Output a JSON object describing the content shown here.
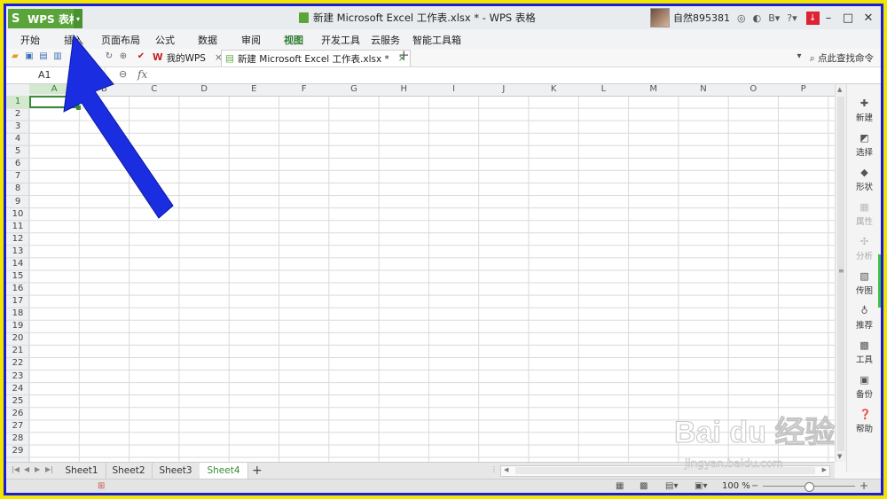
{
  "app": {
    "name_button": "WPS 表格",
    "window_title": "新建 Microsoft Excel 工作表.xlsx * - WPS 表格",
    "username": "自然895381"
  },
  "ribbon": {
    "tabs": [
      "开始",
      "插入",
      "页面布局",
      "公式",
      "数据",
      "审阅",
      "视图",
      "开发工具",
      "云服务",
      "智能工具箱"
    ],
    "active_tab": "视图"
  },
  "doc_tabs": [
    {
      "label": "我的WPS",
      "close": "×"
    },
    {
      "label": "新建 Microsoft Excel 工作表.xlsx *",
      "close": "×"
    }
  ],
  "find_command": "点此查找命令",
  "formula_bar": {
    "name_box": "A1",
    "fx_label": "fx",
    "value": ""
  },
  "columns": [
    "A",
    "B",
    "C",
    "D",
    "E",
    "F",
    "G",
    "H",
    "I",
    "J",
    "K",
    "L",
    "M",
    "N",
    "O",
    "P"
  ],
  "rows": [
    "1",
    "2",
    "3",
    "4",
    "5",
    "6",
    "7",
    "8",
    "9",
    "10",
    "11",
    "12",
    "13",
    "14",
    "15",
    "16",
    "17",
    "18",
    "19",
    "20",
    "21",
    "22",
    "23",
    "24",
    "25",
    "26",
    "27",
    "28",
    "29"
  ],
  "sidebar": [
    {
      "label": "新建",
      "icon": "plus-icon",
      "enabled": true
    },
    {
      "label": "选择",
      "icon": "select-icon",
      "enabled": true
    },
    {
      "label": "形状",
      "icon": "shape-icon",
      "enabled": true
    },
    {
      "label": "属性",
      "icon": "properties-icon",
      "enabled": false
    },
    {
      "label": "分析",
      "icon": "analysis-icon",
      "enabled": false
    },
    {
      "label": "传图",
      "icon": "upload-image-icon",
      "enabled": true
    },
    {
      "label": "推荐",
      "icon": "recommend-icon",
      "enabled": true
    },
    {
      "label": "工具",
      "icon": "toolbox-icon",
      "enabled": true
    },
    {
      "label": "备份",
      "icon": "backup-icon",
      "enabled": true
    },
    {
      "label": "帮助",
      "icon": "help-icon",
      "enabled": true
    }
  ],
  "sheets": [
    "Sheet1",
    "Sheet2",
    "Sheet3",
    "Sheet4"
  ],
  "active_sheet": "Sheet4",
  "status": {
    "zoom": "100 %"
  },
  "watermark": {
    "brand": "Bai du 经验",
    "url": "jingyan.baidu.com"
  },
  "colors": {
    "wps_green": "#5aa53a",
    "frame_blue": "#1a1fd6",
    "frame_yellow": "#f2e600",
    "arrow_blue": "#1a2de0"
  }
}
